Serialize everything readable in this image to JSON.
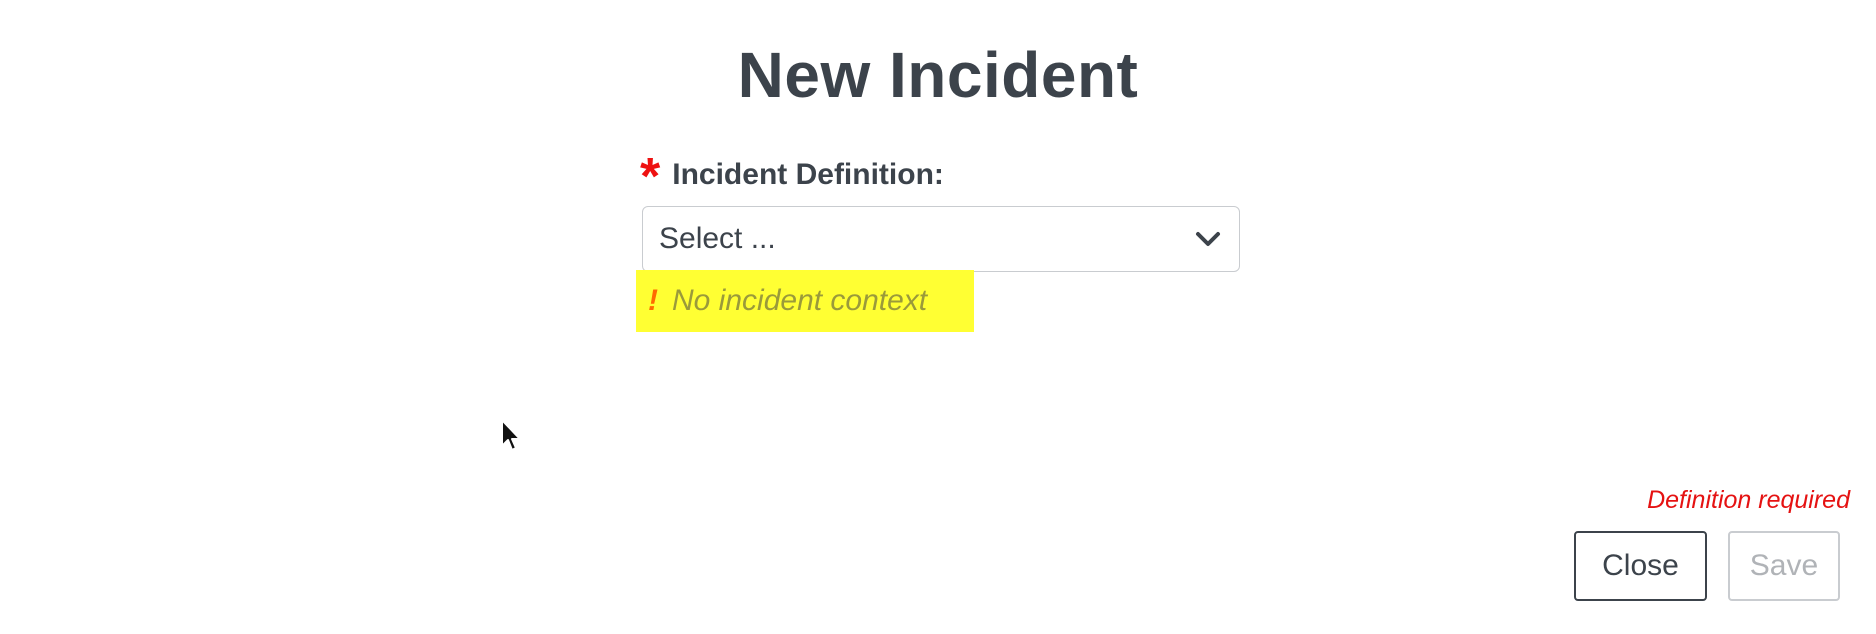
{
  "dialog": {
    "title": "New Incident",
    "definition_field": {
      "required_marker": "*",
      "label": "Incident Definition:",
      "selected_value": "Select ...",
      "icon": "chevron-down-icon"
    },
    "warning": {
      "icon_glyph": "!",
      "text": "No incident context",
      "highlight_color": "#ffff33"
    },
    "validation_message": "Definition required",
    "buttons": {
      "close_label": "Close",
      "save_label": "Save",
      "save_disabled": true
    }
  },
  "colors": {
    "text": "#3c434b",
    "required": "#ee1111",
    "error": "#e51212",
    "warning_icon": "#ff6a00",
    "disabled": "#b0b3b7"
  }
}
